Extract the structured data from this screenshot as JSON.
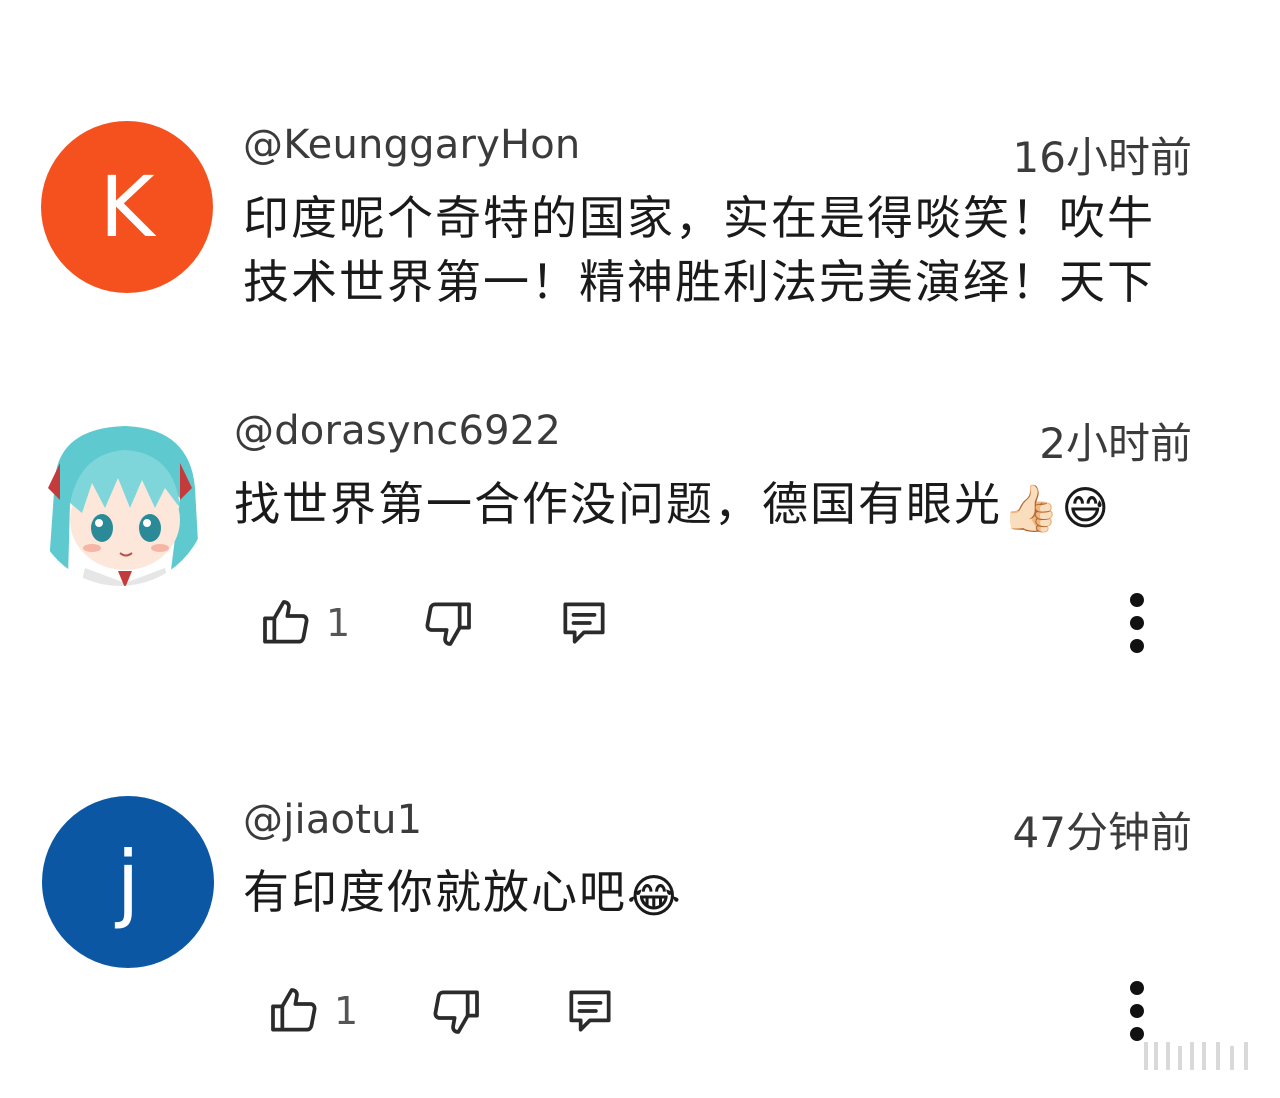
{
  "comments": [
    {
      "author": "@KeunggaryHon",
      "time": "16小时前",
      "avatar_letter": "K",
      "avatar_color": "#f4511e",
      "lines": [
        "印度呢个奇特的国家，实在是得啖笑！吹牛",
        "技术世界第一！精神胜利法完美演绎！天下"
      ]
    },
    {
      "author": "@dorasync6922",
      "time": "2小时前",
      "avatar_icon": "anime-character-avatar",
      "text": "找世界第一合作没问题，德国有眼光",
      "emojis": [
        "👍🏻",
        "😅"
      ],
      "likes": "1"
    },
    {
      "author": "@jiaotu1",
      "time": "47分钟前",
      "avatar_letter": "j",
      "avatar_color": "#0b57a4",
      "text": "有印度你就放心吧",
      "emojis": [
        "😂"
      ],
      "likes": "1"
    }
  ],
  "icons": {
    "like": "thumbs-up-icon",
    "dislike": "thumbs-down-icon",
    "reply": "reply-icon",
    "more": "more-vert-icon"
  }
}
